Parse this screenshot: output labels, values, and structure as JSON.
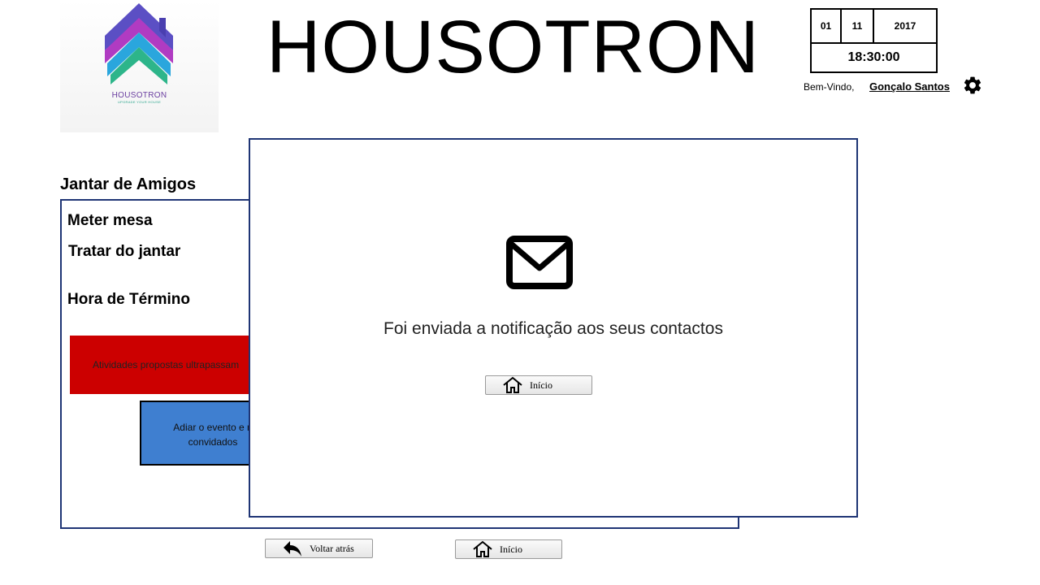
{
  "logo": {
    "name": "HOUSOTRON",
    "tagline": "UPGRADE YOUR HOUSE"
  },
  "header": {
    "title": "HOUSOTRON",
    "date": {
      "day": "01",
      "month": "11",
      "year": "2017"
    },
    "time": "18:30:00",
    "welcome": "Bem-Vindo,",
    "user": "Gonçalo Santos"
  },
  "event": {
    "title": "Jantar de Amigos",
    "items": [
      "Meter mesa",
      "Tratar do jantar",
      "Hora de Término"
    ],
    "alert": "Atividades propostas ultrapassam",
    "action_line1": "Adiar o evento e n",
    "action_line2": "convidados"
  },
  "modal": {
    "message": "Foi enviada a notificação aos seus contactos",
    "home_label": "Início"
  },
  "footer": {
    "back_label": "Voltar atrás",
    "home_label": "Início"
  },
  "colors": {
    "border": "#1f3575",
    "alert": "#cc0000",
    "action": "#3f7fd0"
  },
  "icons": [
    "house-logo-icon",
    "gear-icon",
    "mail-icon",
    "home-icon",
    "back-arrow-icon"
  ]
}
